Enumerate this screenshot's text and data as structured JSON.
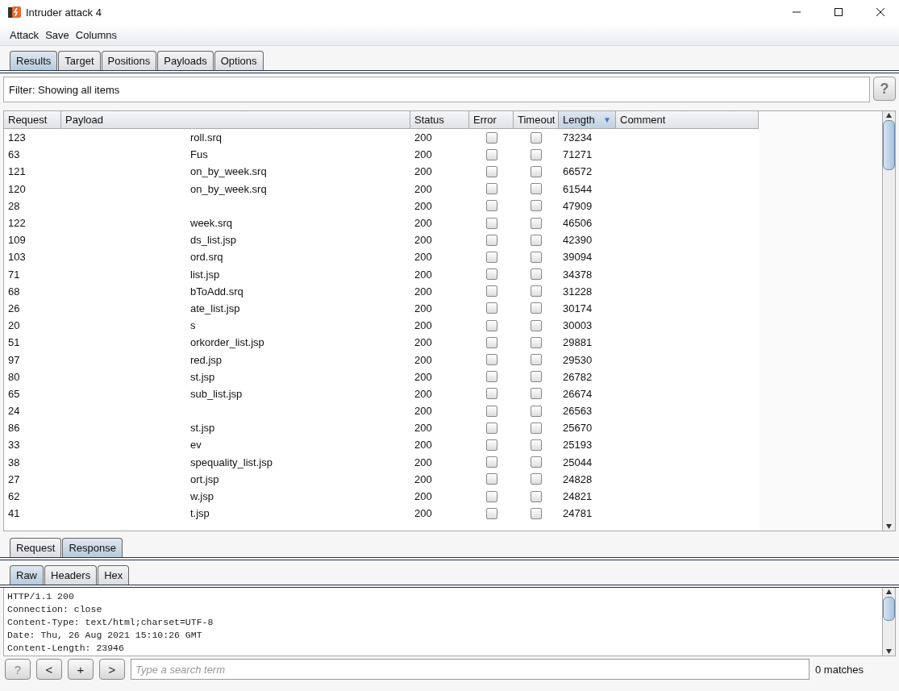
{
  "window": {
    "title": "Intruder attack 4"
  },
  "menu": [
    "Attack",
    "Save",
    "Columns"
  ],
  "tabs": [
    {
      "label": "Results",
      "selected": true
    },
    {
      "label": "Target",
      "selected": false
    },
    {
      "label": "Positions",
      "selected": false
    },
    {
      "label": "Payloads",
      "selected": false
    },
    {
      "label": "Options",
      "selected": false
    }
  ],
  "filter": {
    "text": "Filter: Showing all items",
    "help": "?"
  },
  "table": {
    "columns": [
      {
        "label": "Request",
        "selected": false
      },
      {
        "label": "Payload",
        "selected": false
      },
      {
        "label": "Status",
        "selected": false
      },
      {
        "label": "Error",
        "selected": false
      },
      {
        "label": "Timeout",
        "selected": false
      },
      {
        "label": "Length",
        "selected": true,
        "sort_arrow": "▼"
      },
      {
        "label": "Comment",
        "selected": false
      }
    ],
    "rows": [
      {
        "request": "123",
        "payload": "roll.srq",
        "status": "200",
        "error": false,
        "timeout": false,
        "length": "73234"
      },
      {
        "request": "63",
        "payload": "Fus",
        "status": "200",
        "error": false,
        "timeout": false,
        "length": "71271"
      },
      {
        "request": "121",
        "payload": "on_by_week.srq",
        "status": "200",
        "error": false,
        "timeout": false,
        "length": "66572"
      },
      {
        "request": "120",
        "payload": "on_by_week.srq",
        "status": "200",
        "error": false,
        "timeout": false,
        "length": "61544"
      },
      {
        "request": "28",
        "status": "200",
        "error": false,
        "timeout": false,
        "length": "47909"
      },
      {
        "request": "122",
        "payload": "week.srq",
        "status": "200",
        "error": false,
        "timeout": false,
        "length": "46506"
      },
      {
        "request": "109",
        "payload": "ds_list.jsp",
        "status": "200",
        "error": false,
        "timeout": false,
        "length": "42390"
      },
      {
        "request": "103",
        "payload": "ord.srq",
        "status": "200",
        "error": false,
        "timeout": false,
        "length": "39094"
      },
      {
        "request": "71",
        "payload": "list.jsp",
        "status": "200",
        "error": false,
        "timeout": false,
        "length": "34378"
      },
      {
        "request": "68",
        "payload": "bToAdd.srq",
        "status": "200",
        "error": false,
        "timeout": false,
        "length": "31228"
      },
      {
        "request": "26",
        "payload": "ate_list.jsp",
        "status": "200",
        "error": false,
        "timeout": false,
        "length": "30174"
      },
      {
        "request": "20",
        "payload": "s",
        "status": "200",
        "error": false,
        "timeout": false,
        "length": "30003"
      },
      {
        "request": "51",
        "payload": "orkorder_list.jsp",
        "status": "200",
        "error": false,
        "timeout": false,
        "length": "29881"
      },
      {
        "request": "97",
        "payload": "red.jsp",
        "status": "200",
        "error": false,
        "timeout": false,
        "length": "29530"
      },
      {
        "request": "80",
        "payload": "st.jsp",
        "status": "200",
        "error": false,
        "timeout": false,
        "length": "26782"
      },
      {
        "request": "65",
        "payload": "sub_list.jsp",
        "status": "200",
        "error": false,
        "timeout": false,
        "length": "26674"
      },
      {
        "request": "24",
        "status": "200",
        "error": false,
        "timeout": false,
        "length": "26563"
      },
      {
        "request": "86",
        "payload": "st.jsp",
        "status": "200",
        "error": false,
        "timeout": false,
        "length": "25670"
      },
      {
        "request": "33",
        "payload": "ev",
        "status": "200",
        "error": false,
        "timeout": false,
        "length": "25193"
      },
      {
        "request": "38",
        "payload": "spequality_list.jsp",
        "status": "200",
        "error": false,
        "timeout": false,
        "length": "25044"
      },
      {
        "request": "27",
        "payload": "ort.jsp",
        "status": "200",
        "error": false,
        "timeout": false,
        "length": "24828"
      },
      {
        "request": "62",
        "payload": "w.jsp",
        "status": "200",
        "error": false,
        "timeout": false,
        "length": "24821"
      },
      {
        "request": "41",
        "payload": "t.jsp",
        "status": "200",
        "error": false,
        "timeout": false,
        "length": "24781"
      }
    ]
  },
  "message_tabs": [
    {
      "label": "Request",
      "selected": false
    },
    {
      "label": "Response",
      "selected": true
    }
  ],
  "view_tabs": [
    {
      "label": "Raw",
      "selected": true
    },
    {
      "label": "Headers",
      "selected": false
    },
    {
      "label": "Hex",
      "selected": false
    }
  ],
  "response_lines": [
    "HTTP/1.1 200",
    "Connection: close",
    "Content-Type: text/html;charset=UTF-8",
    "Date: Thu, 26 Aug 2021 15:10:26 GMT",
    "Content-Length: 23946"
  ],
  "search": {
    "buttons": [
      "?",
      "<",
      "+",
      ">"
    ],
    "placeholder": "Type a search term",
    "matches": "0 matches"
  }
}
